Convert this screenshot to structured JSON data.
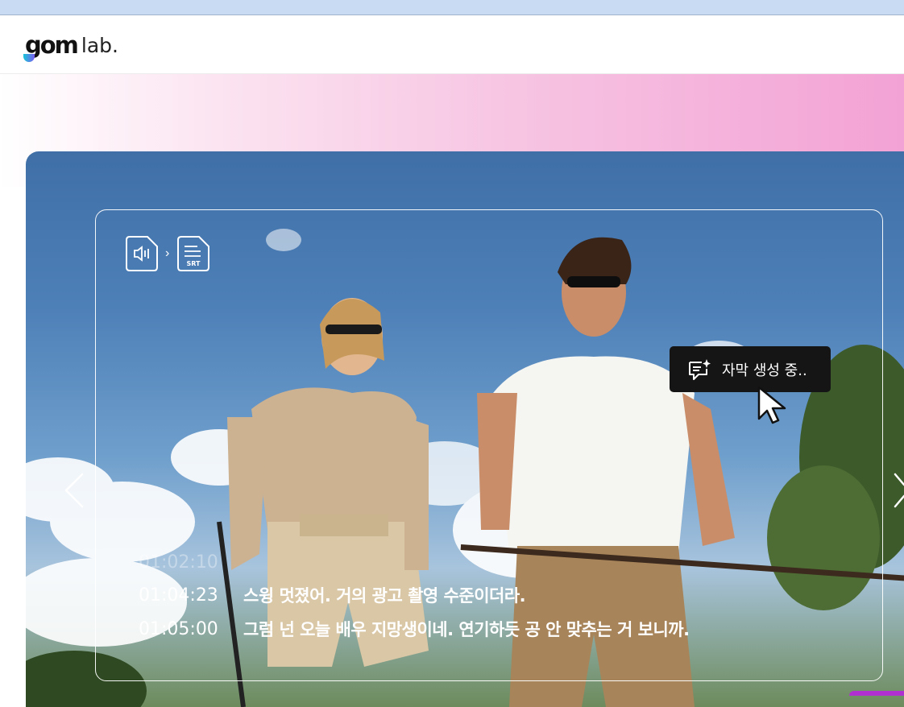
{
  "header": {
    "logo_gom": "gom",
    "logo_lab": "lab."
  },
  "icons": {
    "audio_file": "audio-file-icon",
    "srt_file": "srt-file-icon",
    "srt_label": "SRT",
    "arrow": "›",
    "subtitle_spark": "subtitle-sparkle-icon",
    "cursor": "mouse-cursor-icon"
  },
  "tooltip": {
    "text": "자막 생성 중.."
  },
  "subtitles": [
    {
      "time": "01:02:10",
      "text": ""
    },
    {
      "time": "01:04:23",
      "text": "스윙 멋졌어. 거의 광고 촬영 수준이더라."
    },
    {
      "time": "01:05:00",
      "text": "그럼 넌 오늘 배우 지망생이네. 연기하듯 공 안 맞추는 거 보니까."
    }
  ],
  "colors": {
    "accent_gradient_start": "#fce6f2",
    "accent_gradient_end": "#f3a2d5",
    "tooltip_bg": "#151515",
    "sky": "#4e80b8"
  }
}
